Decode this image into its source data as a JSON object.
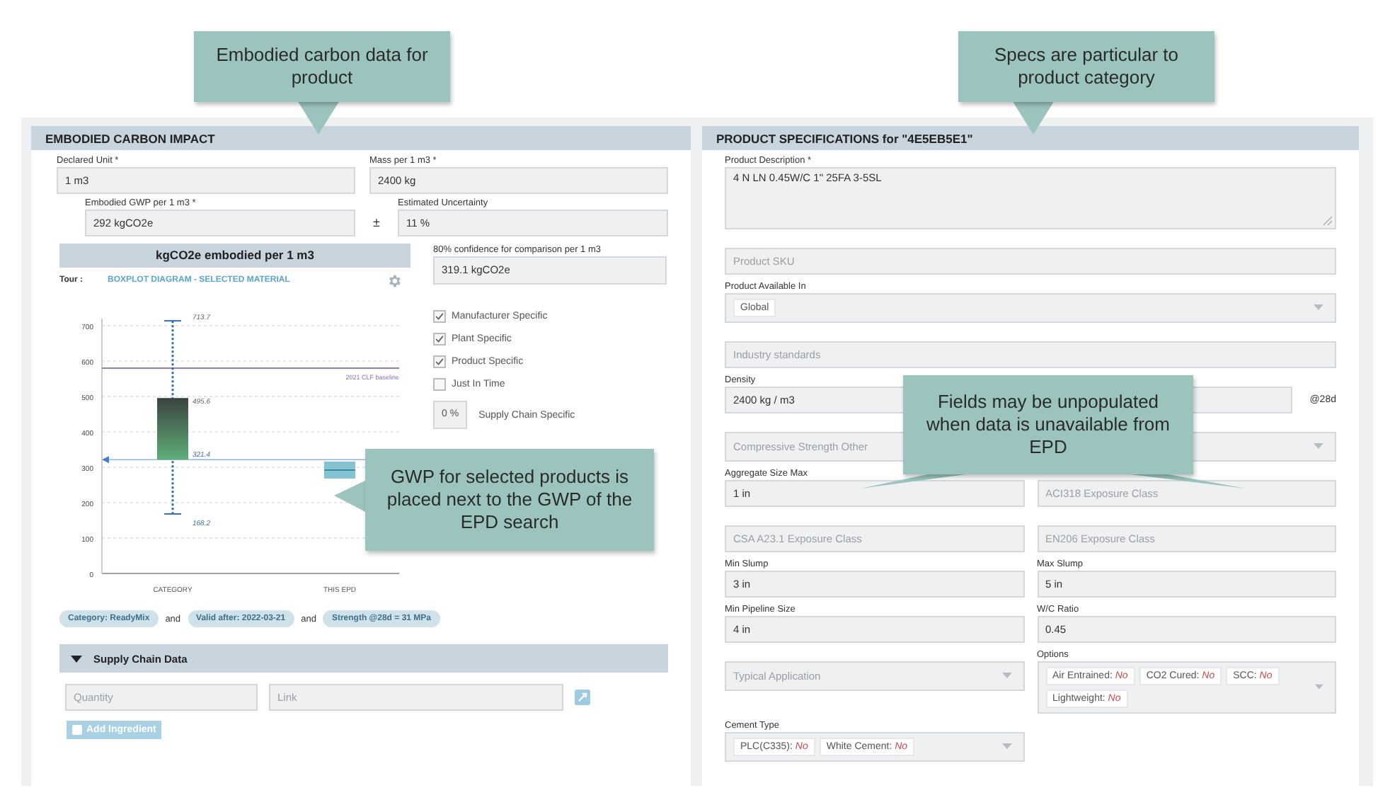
{
  "callouts": [
    {
      "text": "Embodied carbon data for product"
    },
    {
      "text": "Specs are particular to product category"
    },
    {
      "text": "Fields may be unpopulated when data is unavailable from EPD"
    },
    {
      "text": "GWP for selected products is placed next to the GWP of the EPD search"
    }
  ],
  "embodied": {
    "title": "EMBODIED CARBON IMPACT",
    "declared_unit": {
      "label": "Declared Unit *",
      "value": "1 m3"
    },
    "mass": {
      "label": "Mass per 1 m3 *",
      "value": "2400 kg"
    },
    "gwp": {
      "label": "Embodied GWP per 1 m3 *",
      "value": "292 kgCO2e"
    },
    "plus_minus": "±",
    "uncertainty": {
      "label": "Estimated Uncertainty",
      "value": "11 %"
    },
    "tour_label": "Tour :",
    "chart_link": "BOXPLOT DIAGRAM - SELECTED MATERIAL",
    "boxplot": {
      "title": "kgCO2e embodied per 1 m3",
      "y_ticks": [
        "700",
        "600",
        "500",
        "400",
        "300",
        "200",
        "100",
        "0"
      ],
      "categories": [
        "CATEGORY",
        "THIS EPD"
      ],
      "value_labels": [
        "713.7",
        "495.6",
        "321.4",
        "168.2"
      ],
      "baseline_label": "2021 CLF baseline"
    },
    "confidence": {
      "label": "80% confidence for comparison per 1 m3",
      "value": "319.1 kgCO2e"
    },
    "checkboxes": [
      {
        "label": "Manufacturer Specific",
        "checked": true
      },
      {
        "label": "Plant Specific",
        "checked": true
      },
      {
        "label": "Product Specific",
        "checked": true
      },
      {
        "label": "Just In Time",
        "checked": false
      }
    ],
    "supply_chain_specific": {
      "value": "0 %",
      "label": "Supply Chain Specific"
    },
    "filters": [
      {
        "kind": "tag",
        "text": "Category: ReadyMix"
      },
      {
        "kind": "joiner",
        "text": "and"
      },
      {
        "kind": "tag",
        "text": "Valid after: 2022-03-21"
      },
      {
        "kind": "joiner",
        "text": "and"
      },
      {
        "kind": "tag",
        "text": "Strength @28d = 31 MPa"
      }
    ],
    "supply_chain": {
      "title": "Supply Chain Data",
      "expanded": true,
      "quantity_placeholder": "Quantity",
      "link_placeholder": "Link",
      "add_button": {
        "label": "Add Ingredient",
        "disabled": true
      }
    }
  },
  "specs": {
    "title": "PRODUCT SPECIFICATIONS for \"4E5EB5E1\"",
    "rows": [
      {
        "fields": [
          {
            "kind": "textarea",
            "wide": true,
            "label": "Product Description *",
            "value": "4 N LN 0.45W/C 1\" 25FA 3-5SL"
          }
        ]
      },
      {
        "fields": [
          {
            "kind": "input",
            "wide": true,
            "placeholder": "Product SKU"
          }
        ]
      },
      {
        "fields": [
          {
            "kind": "select",
            "wide": true,
            "label": "Product Available In",
            "tags": [
              {
                "name": "Global"
              }
            ]
          }
        ]
      },
      {
        "fields": [
          {
            "kind": "input",
            "wide": true,
            "placeholder": "Industry standards"
          }
        ]
      },
      {
        "fields": [
          {
            "kind": "input",
            "label": "Density",
            "value": "2400 kg / m3"
          },
          {
            "kind": "input",
            "suffix": "@28d"
          }
        ]
      },
      {
        "fields": [
          {
            "kind": "select",
            "wide": true,
            "placeholder": "Compressive Strength Other"
          }
        ]
      },
      {
        "fields": [
          {
            "kind": "input",
            "label": "Aggregate Size Max",
            "value": "1 in"
          },
          {
            "kind": "input",
            "placeholder": "ACI318 Exposure Class"
          }
        ]
      },
      {
        "fields": [
          {
            "kind": "input",
            "placeholder": "CSA A23.1 Exposure Class"
          },
          {
            "kind": "input",
            "placeholder": "EN206 Exposure Class"
          }
        ]
      },
      {
        "fields": [
          {
            "kind": "input",
            "label": "Min Slump",
            "value": "3 in"
          },
          {
            "kind": "input",
            "label": "Max Slump",
            "value": "5 in"
          }
        ]
      },
      {
        "fields": [
          {
            "kind": "input",
            "label": "Min Pipeline Size",
            "value": "4 in"
          },
          {
            "kind": "input",
            "label": "W/C Ratio",
            "value": "0.45"
          }
        ]
      },
      {
        "fields": [
          {
            "kind": "select",
            "placeholder": "Typical Application"
          },
          {
            "kind": "select",
            "label": "Options",
            "tags": [
              {
                "name": "Air Entrained:",
                "value": "No"
              },
              {
                "name": "CO2 Cured:",
                "value": "No"
              },
              {
                "name": "SCC:",
                "value": "No"
              },
              {
                "name": "Lightweight:",
                "value": "No"
              }
            ]
          }
        ]
      },
      {
        "fields": [
          {
            "kind": "select",
            "label": "Cement Type",
            "tags": [
              {
                "name": "PLC(C335):",
                "value": "No"
              },
              {
                "name": "White Cement:",
                "value": "No"
              }
            ]
          }
        ]
      }
    ]
  }
}
